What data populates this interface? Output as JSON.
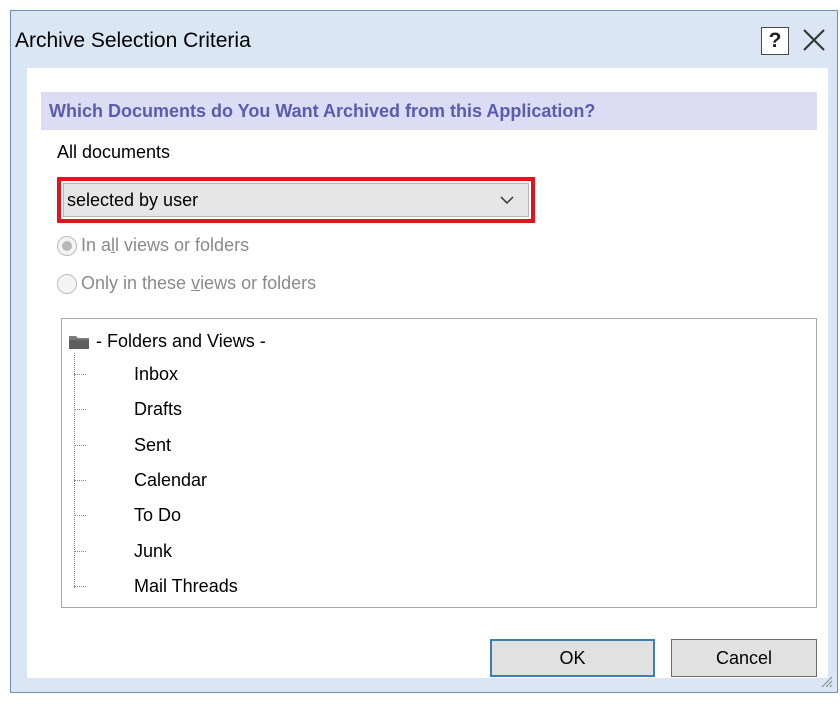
{
  "window": {
    "title": "Archive Selection Criteria",
    "help_glyph": "?",
    "close_icon": "close-icon"
  },
  "question": {
    "text": "Which Documents do You Want Archived from this Application?"
  },
  "scope": {
    "label": "All documents",
    "selected_value": "selected by user",
    "highlight_color": "#e4131b"
  },
  "radios": [
    {
      "label_before": "In a",
      "mnemonic": "l",
      "label_after": "l views or folders",
      "checked": true,
      "enabled": false
    },
    {
      "label_before": "Only in these ",
      "mnemonic": "v",
      "label_after": "iews or folders",
      "checked": false,
      "enabled": false
    }
  ],
  "tree": {
    "root_label": "- Folders and Views -",
    "items": [
      "Inbox",
      "Drafts",
      "Sent",
      "Calendar",
      "To Do",
      "Junk",
      "Mail Threads"
    ]
  },
  "buttons": {
    "ok": "OK",
    "cancel": "Cancel"
  },
  "colors": {
    "frame": "#dae6f3",
    "banner_bg": "#dcdcf5",
    "banner_text": "#5b5bb0"
  }
}
